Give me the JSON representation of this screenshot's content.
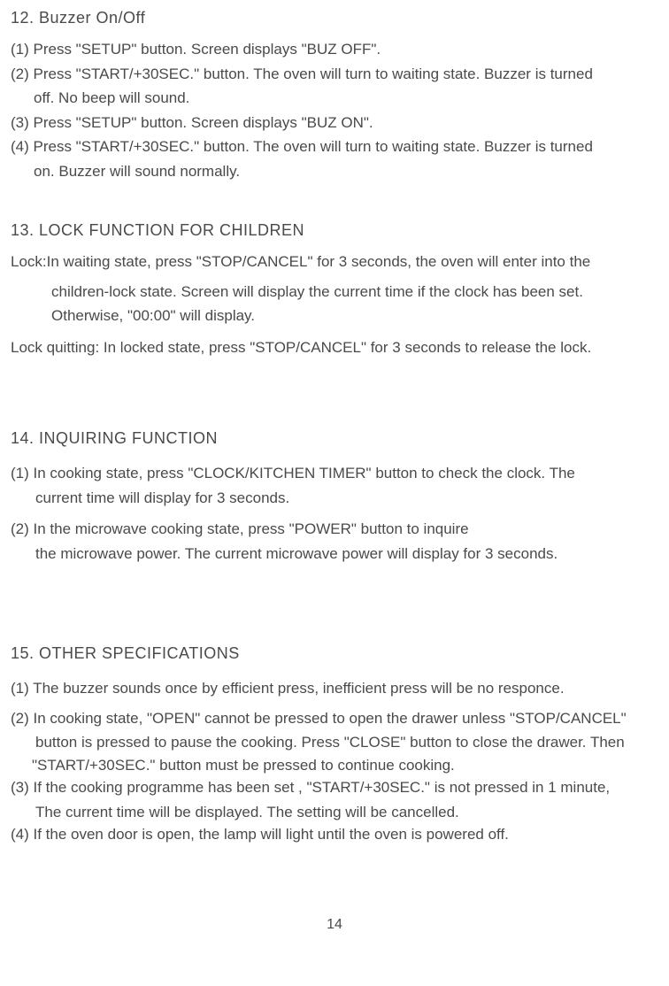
{
  "section12": {
    "heading": "12. Buzzer On/Off",
    "items": [
      "(1) Press \"SETUP\" button. Screen displays \"BUZ OFF\".",
      "(2) Press \"START/+30SEC.\" button. The oven will turn to waiting state. Buzzer is turned",
      "off. No beep will sound.",
      "(3) Press \"SETUP\" button. Screen displays \"BUZ ON\".",
      "(4) Press \"START/+30SEC.\" button. The oven will turn to waiting state. Buzzer is turned",
      "on. Buzzer will sound normally."
    ]
  },
  "section13": {
    "heading": "13. LOCK FUNCTION FOR CHILDREN",
    "lockLabel": "Lock: ",
    "lockLine1": "In waiting state, press \"STOP/CANCEL\" for 3 seconds, the oven will enter into the",
    "lockLine2": "children-lock state. Screen will display the current time if the clock has been set.",
    "lockLine3": "Otherwise, \"00:00\" will display.",
    "quitText": "Lock quitting: In locked state, press \"STOP/CANCEL\" for 3 seconds to release the lock."
  },
  "section14": {
    "heading": "14. INQUIRING FUNCTION",
    "item1a": "(1) In cooking state, press \"CLOCK/KITCHEN TIMER\" button to check the clock. The",
    "item1b": "current time will display for 3 seconds.",
    "item2a": "(2) In the microwave cooking state, press \"POWER\" button to inquire",
    "item2b": "the microwave power. The current microwave power will display for 3 seconds."
  },
  "section15": {
    "heading": "15. OTHER SPECIFICATIONS",
    "item1": "(1) The buzzer sounds once by efficient press, inefficient press will be no responce.",
    "item2a": "(2) In cooking state, \"OPEN\" cannot be pressed to open the drawer unless \"STOP/CANCEL\"",
    "item2b": "button is pressed to pause the cooking. Press \"CLOSE\" button to close the drawer. Then",
    "item2c": "\"START/+30SEC.\" button must be pressed to continue cooking.",
    "item3a": "(3) If the cooking programme has been set , \"START/+30SEC.\" is not pressed in 1 minute,",
    "item3b": "The current time will be displayed. The setting will be cancelled.",
    "item4": "(4) If the oven door is open, the lamp will light until the oven is powered off."
  },
  "pageNumber": "14"
}
